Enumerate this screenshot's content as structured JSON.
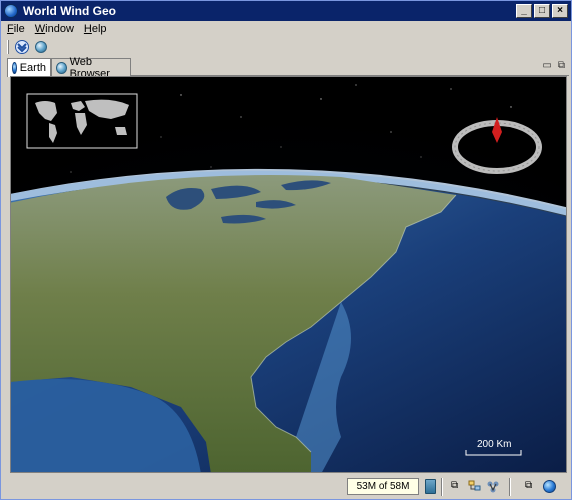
{
  "window": {
    "title": "World Wind Geo"
  },
  "menu": {
    "file": "File",
    "window": "Window",
    "help": "Help"
  },
  "tabs": [
    {
      "label": "Earth",
      "active": true
    },
    {
      "label": "Web Browser",
      "active": false
    }
  ],
  "map": {
    "scale_label": "200 Km",
    "compass_heading_deg": 0
  },
  "status": {
    "memory": "53M of 58M"
  },
  "colors": {
    "title_bar": "#0a246a",
    "ocean": "#1a3f7a",
    "land": "#6f7f4a",
    "compass_needle": "#d21f1f"
  }
}
